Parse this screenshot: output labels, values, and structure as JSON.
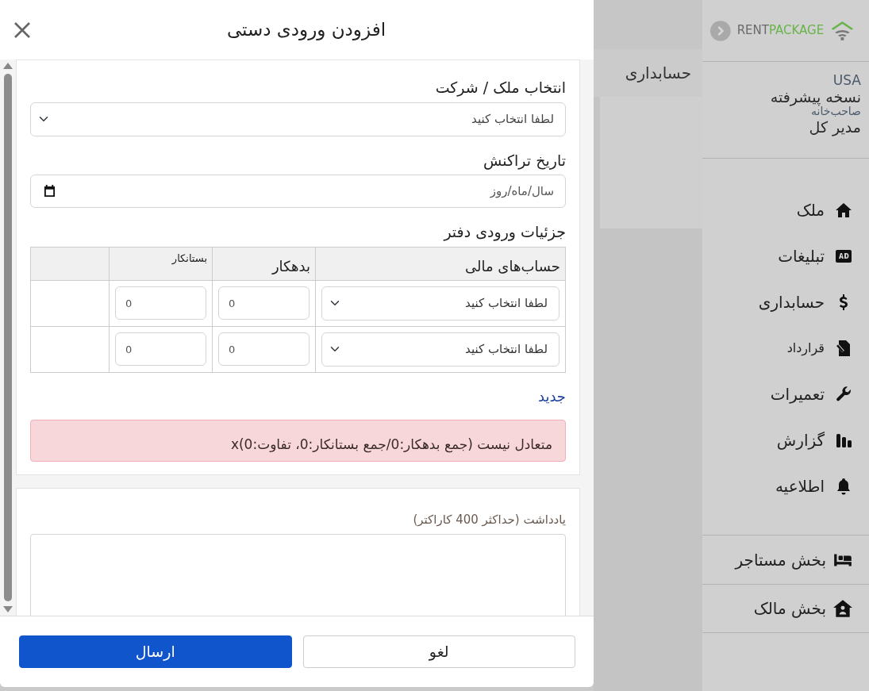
{
  "sidebar": {
    "logo": {
      "text_dark": "RENT",
      "text_green": "PACKAGE"
    },
    "user": {
      "country": "USA",
      "plan": "نسخه پیشرفته",
      "account_type": "صاحب‌خانه",
      "role": "مدیر کل"
    },
    "items": [
      {
        "label": "ملک",
        "kind": "home"
      },
      {
        "label": "تبلیغات",
        "kind": "ad"
      },
      {
        "label": "حسابداری",
        "kind": "dollar"
      },
      {
        "label": "قرارداد",
        "kind": "contract"
      },
      {
        "label": "تعمیرات",
        "kind": "wrench"
      },
      {
        "label": "گزارش",
        "kind": "chart"
      },
      {
        "label": "اطلاعیه",
        "kind": "bell"
      }
    ],
    "sections": [
      {
        "label": "بخش مستاجر",
        "kind": "bed"
      },
      {
        "label": "بخش مالک",
        "kind": "owner"
      }
    ]
  },
  "page_title": "حسابداری",
  "modal": {
    "title": "افزودن ورودی دستی",
    "property": {
      "label": "انتخاب ملک / شرکت",
      "value": "لطفا انتخاب کنید"
    },
    "date": {
      "label": "تاریخ تراکنش",
      "placeholder": "سال/ماه/روز"
    },
    "ledger": {
      "heading": "جزئیات ورودی دفتر",
      "columns": [
        "حساب‌های مالی",
        "بدهکار",
        "بستانکار"
      ],
      "rows": [
        {
          "account": "لطفا انتخاب کنید",
          "debit": "0",
          "credit": "0"
        },
        {
          "account": "لطفا انتخاب کنید",
          "debit": "0",
          "credit": "0"
        }
      ],
      "new_link": "جدید",
      "alert": "متعادل نیست (جمع بدهکار:0/جمع بستانکار:0، تفاوت:0)x"
    },
    "note": {
      "label": "یادداشت (حداکثر 400 کاراکتر)"
    },
    "buttons": [
      {
        "label": "لغو",
        "kind": "secondary"
      },
      {
        "label": "ارسال",
        "kind": "primary"
      }
    ]
  }
}
